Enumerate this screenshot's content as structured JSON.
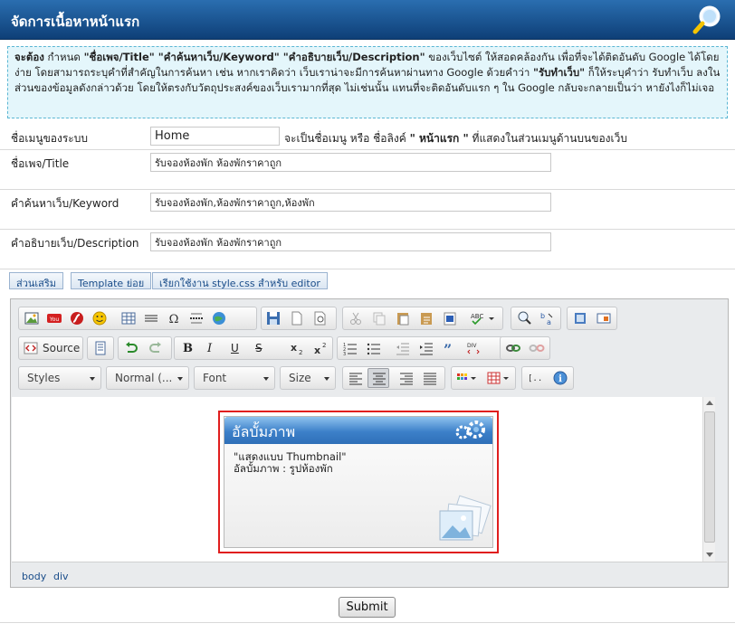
{
  "header": {
    "title": "จัดการเนื้อหาหน้าแรก"
  },
  "notice": {
    "t1": "จะต้อง",
    "t2": " กำหนด ",
    "b1": "\"ชื่อเพจ/Title\" \"คำค้นหาเว็บ/Keyword\" \"คำอธิบายเว็บ/Description\"",
    "t3": " ของเว็บไซต์ ให้สอดคล้องกัน เพื่อที่จะได้ติดอันดับ Google ได้โดยง่าย โดยสามารถระบุคำที่สำคัญในการค้นหา เช่น หากเราคิดว่า เว็บเราน่าจะมีการค้นหาผ่านทาง Google ด้วยคำว่า ",
    "b2": "\"รับทำเว็บ\"",
    "t4": " ก็ให้ระบุคำว่า รับทำเว็บ ลงในส่วนของข้อมูลดังกล่าวด้วย โดยให้ตรงกับวัตถุประสงค์ของเว็บเรามากที่สุด ไม่เช่นนั้น แทนที่จะติดอันดับแรก ๆ ใน Google กลับจะกลายเป็นว่า หายังไงก็ไม่เจอ"
  },
  "form": {
    "menu_label": "ชื่อเมนูของระบบ",
    "menu_value": "Home",
    "menu_hint_pre": "จะเป็นชื่อเมนู หรือ ชื่อลิงค์ ",
    "menu_hint_bold": "\" หน้าแรก \"",
    "menu_hint_post": " ที่แสดงในส่วนเมนูด้านบนของเว็บ",
    "title_label": "ชื่อเพจ/Title",
    "title_value": "รับจองห้องพัก ห้องพักราคาถูก",
    "keyword_label": "คำค้นหาเว็บ/Keyword",
    "keyword_value": "รับจองห้องพัก,ห้องพักราคาถูก,ห้องพัก",
    "desc_label": "คำอธิบายเว็บ/Description",
    "desc_value": "รับจองห้องพัก ห้องพักราคาถูก"
  },
  "tabs": [
    "ส่วนเสริม",
    "Template ย่อย",
    "เรียกใช้งาน style.css สำหรับ editor"
  ],
  "editor": {
    "source_label": "Source",
    "styles_label": "Styles",
    "format_label": "Normal (...",
    "font_label": "Font",
    "size_label": "Size",
    "widget_title": "อัลบั้มภาพ",
    "widget_line1": "\"แสดงแบบ Thumbnail\"",
    "widget_line2": "อัลบั้มภาพ : รูปห้องพัก",
    "path": [
      "body",
      "div"
    ]
  },
  "submit_label": "Submit",
  "colors": {
    "header": "#1a528f",
    "notice_bg": "#e4f6fb",
    "widget_border": "#e01e1e"
  }
}
